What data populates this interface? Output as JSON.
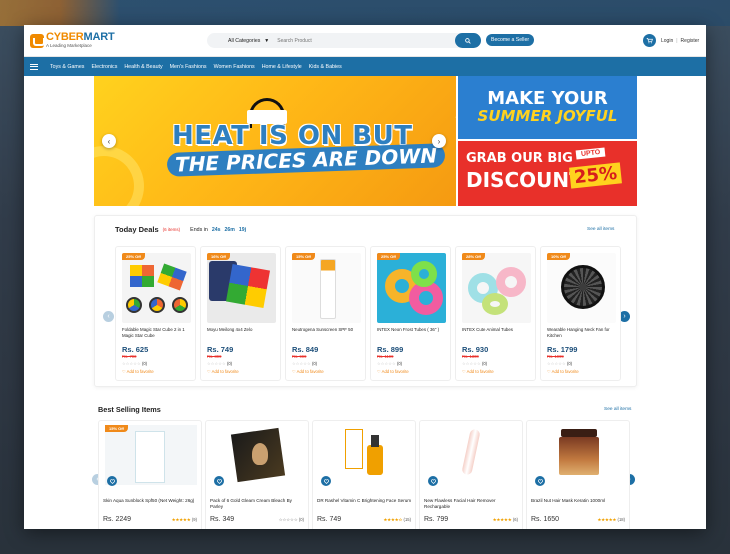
{
  "brand": {
    "name_a": "CYBER",
    "name_b": "MART",
    "tagline": "A Leading Marketplace"
  },
  "search": {
    "category": "All Categories",
    "placeholder": "Search Product"
  },
  "header": {
    "seller_button": "Become a Seller",
    "login": "Login",
    "sep": "|",
    "register": "Register"
  },
  "nav": [
    "Toys & Games",
    "Electronics",
    "Health & Beauty",
    "Men's Fashions",
    "Women Fashions",
    "Home & Lifestyle",
    "Kids & Babies"
  ],
  "banner": {
    "headline_line1": "HEAT IS ON BUT",
    "headline_line2": "THE PRICES ARE DOWN",
    "promo_top_line1": "MAKE YOUR",
    "promo_top_line2": "SUMMER JOYFUL",
    "promo_bottom_line1": "GRAB OUR BIG",
    "promo_bottom_line2": "DISCOUNT",
    "promo_upto": "UPTO",
    "promo_percent": "25%"
  },
  "deals": {
    "title": "Today Deals",
    "count": "(6 items)",
    "ends_label": "Ends in",
    "timer": [
      "24s",
      "26m",
      "19j"
    ],
    "see_all": "See all items",
    "fav_label": "♡ Add to favorite",
    "items": [
      {
        "badge": "25% Off",
        "name": "Foldable Magic Star Cube 2 in 1 Magic Star Cube",
        "price": "Rs. 625",
        "old": "Rs. 700",
        "rating": "☆☆☆☆☆",
        "reviews": "(0)"
      },
      {
        "badge": "16% Off",
        "name": "Moyu Meilong 4x4 Zelo",
        "price": "Rs. 749",
        "old": "Rs. 899",
        "rating": "☆☆☆☆☆",
        "reviews": "(0)"
      },
      {
        "badge": "15% Off",
        "name": "Neutrogena Sunscreen SPF 50",
        "price": "Rs. 849",
        "old": "Rs. 999",
        "rating": "☆☆☆☆☆",
        "reviews": "(0)"
      },
      {
        "badge": "25% Off",
        "name": "INTEX Neon Frost Tubes ( 36\" )",
        "price": "Rs. 899",
        "old": "Rs. 1199",
        "rating": "☆☆☆☆☆",
        "reviews": "(0)"
      },
      {
        "badge": "28% Off",
        "name": "INTEX Cute Animal Tubes",
        "price": "Rs. 930",
        "old": "Rs. 1300",
        "rating": "☆☆☆☆☆",
        "reviews": "(0)"
      },
      {
        "badge": "10% Off",
        "name": "Wearable Hanging Neck Fan for Kitchen",
        "price": "Rs. 1799",
        "old": "Rs. 1999",
        "rating": "☆☆☆☆☆",
        "reviews": "(0)"
      }
    ]
  },
  "best": {
    "title": "Best Selling Items",
    "see_all": "See all items",
    "items": [
      {
        "badge": "15% Off",
        "name": "Skin Aqua Sunblock Spf50 (Net Weight: 26g)",
        "price": "Rs. 2249",
        "stars": "★★★★★",
        "reviews": "(9)"
      },
      {
        "name": "Pack of 6 Gold Gleam Cream Bleach By Parley",
        "price": "Rs. 349",
        "stars": "☆☆☆☆☆",
        "reviews": "(0)"
      },
      {
        "name": "DR Rashel Vitamin C Brightening Face Serum",
        "price": "Rs. 749",
        "stars": "★★★★☆",
        "reviews": "(15)"
      },
      {
        "name": "New Flawless Facial Hair Remover Rechargable",
        "price": "Rs. 799",
        "stars": "★★★★★",
        "reviews": "(6)"
      },
      {
        "name": "Brazil Nut Hair Mask Keratin 1000ml",
        "price": "Rs. 1650",
        "stars": "★★★★★",
        "reviews": "(18)"
      }
    ]
  },
  "colors": {
    "brand_blue": "#1d6fa5",
    "brand_orange": "#f08a1a",
    "sale_red": "#e8302a"
  }
}
